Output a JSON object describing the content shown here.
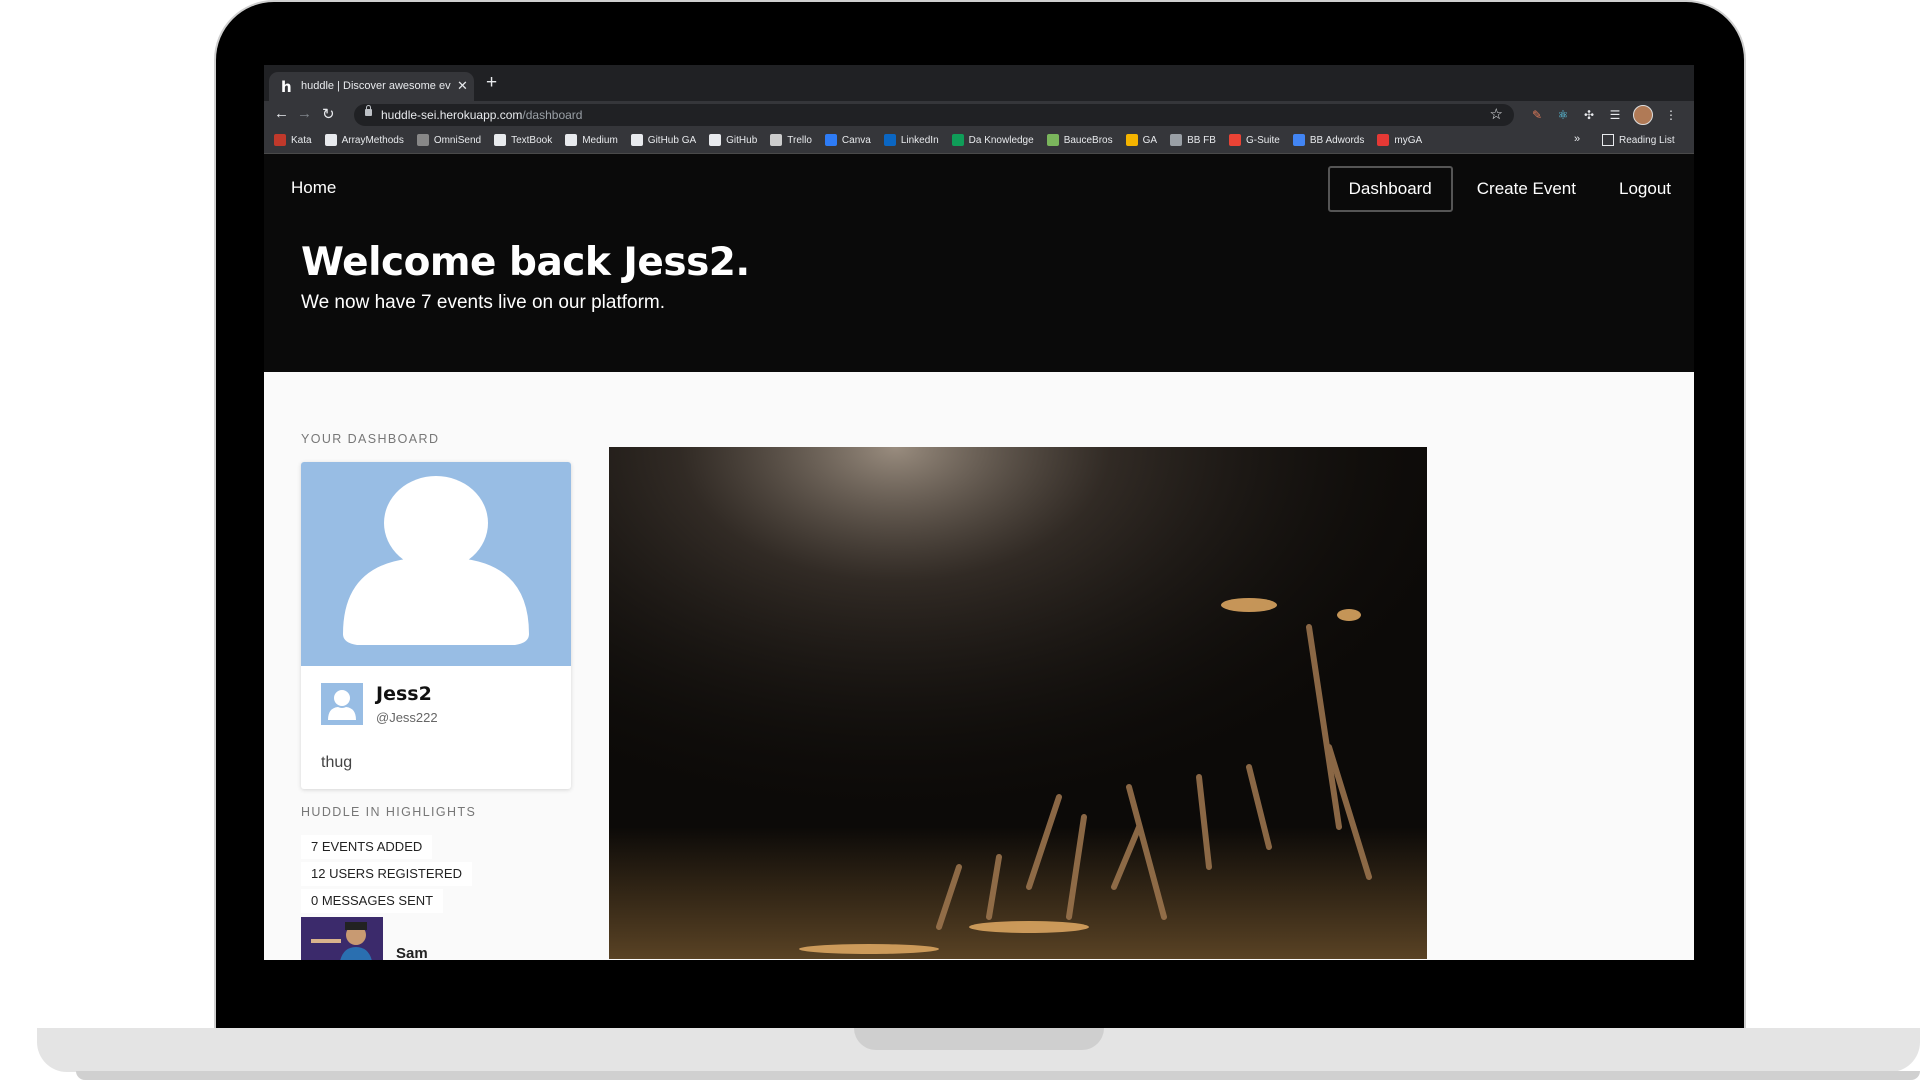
{
  "browser": {
    "tab_title": "huddle | Discover awesome events",
    "tab_favicon": "h",
    "url_host": "huddle-sei.herokuapp.com",
    "url_path": "/dashboard",
    "bookmarks": [
      {
        "label": "Kata",
        "icon": "kata-icon",
        "color": "#c0392b"
      },
      {
        "label": "ArrayMethods",
        "icon": "medium-icon",
        "color": "#e8eaed"
      },
      {
        "label": "OmniSend",
        "icon": "omnisend-icon",
        "color": "#888888"
      },
      {
        "label": "TextBook",
        "icon": "github-icon",
        "color": "#e8eaed"
      },
      {
        "label": "Medium",
        "icon": "medium-icon",
        "color": "#e8eaed"
      },
      {
        "label": "GitHub GA",
        "icon": "github-icon",
        "color": "#e8eaed"
      },
      {
        "label": "GitHub",
        "icon": "github-icon",
        "color": "#e8eaed"
      },
      {
        "label": "Trello",
        "icon": "trello-icon",
        "color": "#cccccc"
      },
      {
        "label": "Canva",
        "icon": "canva-icon",
        "color": "#2e7cf6"
      },
      {
        "label": "LinkedIn",
        "icon": "linkedin-icon",
        "color": "#0a66c2"
      },
      {
        "label": "Da Knowledge",
        "icon": "sheets-icon",
        "color": "#0f9d58"
      },
      {
        "label": "BauceBros",
        "icon": "shopify-icon",
        "color": "#7ab55c"
      },
      {
        "label": "GA",
        "icon": "analytics-icon",
        "color": "#f4b400"
      },
      {
        "label": "BB FB",
        "icon": "bookmark-icon",
        "color": "#9aa0a6"
      },
      {
        "label": "G-Suite",
        "icon": "google-icon",
        "color": "#ea4335"
      },
      {
        "label": "BB Adwords",
        "icon": "adwords-icon",
        "color": "#4285f4"
      },
      {
        "label": "myGA",
        "icon": "myga-icon",
        "color": "#e53935"
      }
    ],
    "more_label": "»",
    "reading_list": "Reading List"
  },
  "nav": {
    "home": "Home",
    "dashboard": "Dashboard",
    "create_event": "Create Event",
    "logout": "Logout"
  },
  "hero": {
    "welcome": "Welcome back Jess2.",
    "subtitle": "We now have 7 events live on our platform."
  },
  "dashboard": {
    "section_label": "YOUR DASHBOARD",
    "profile": {
      "name": "Jess2",
      "handle": "@Jess222",
      "bio": "thug"
    },
    "highlights_label": "HUDDLE IN HIGHLIGHTS",
    "highlights": [
      "7 EVENTS ADDED",
      "12 USERS REGISTERED",
      "0 MESSAGES SENT"
    ],
    "recent_user": "Sam"
  },
  "colors": {
    "header_bg": "#0a0a0a",
    "avatar_placeholder": "#98bde4",
    "page_bg": "#fafafa"
  }
}
